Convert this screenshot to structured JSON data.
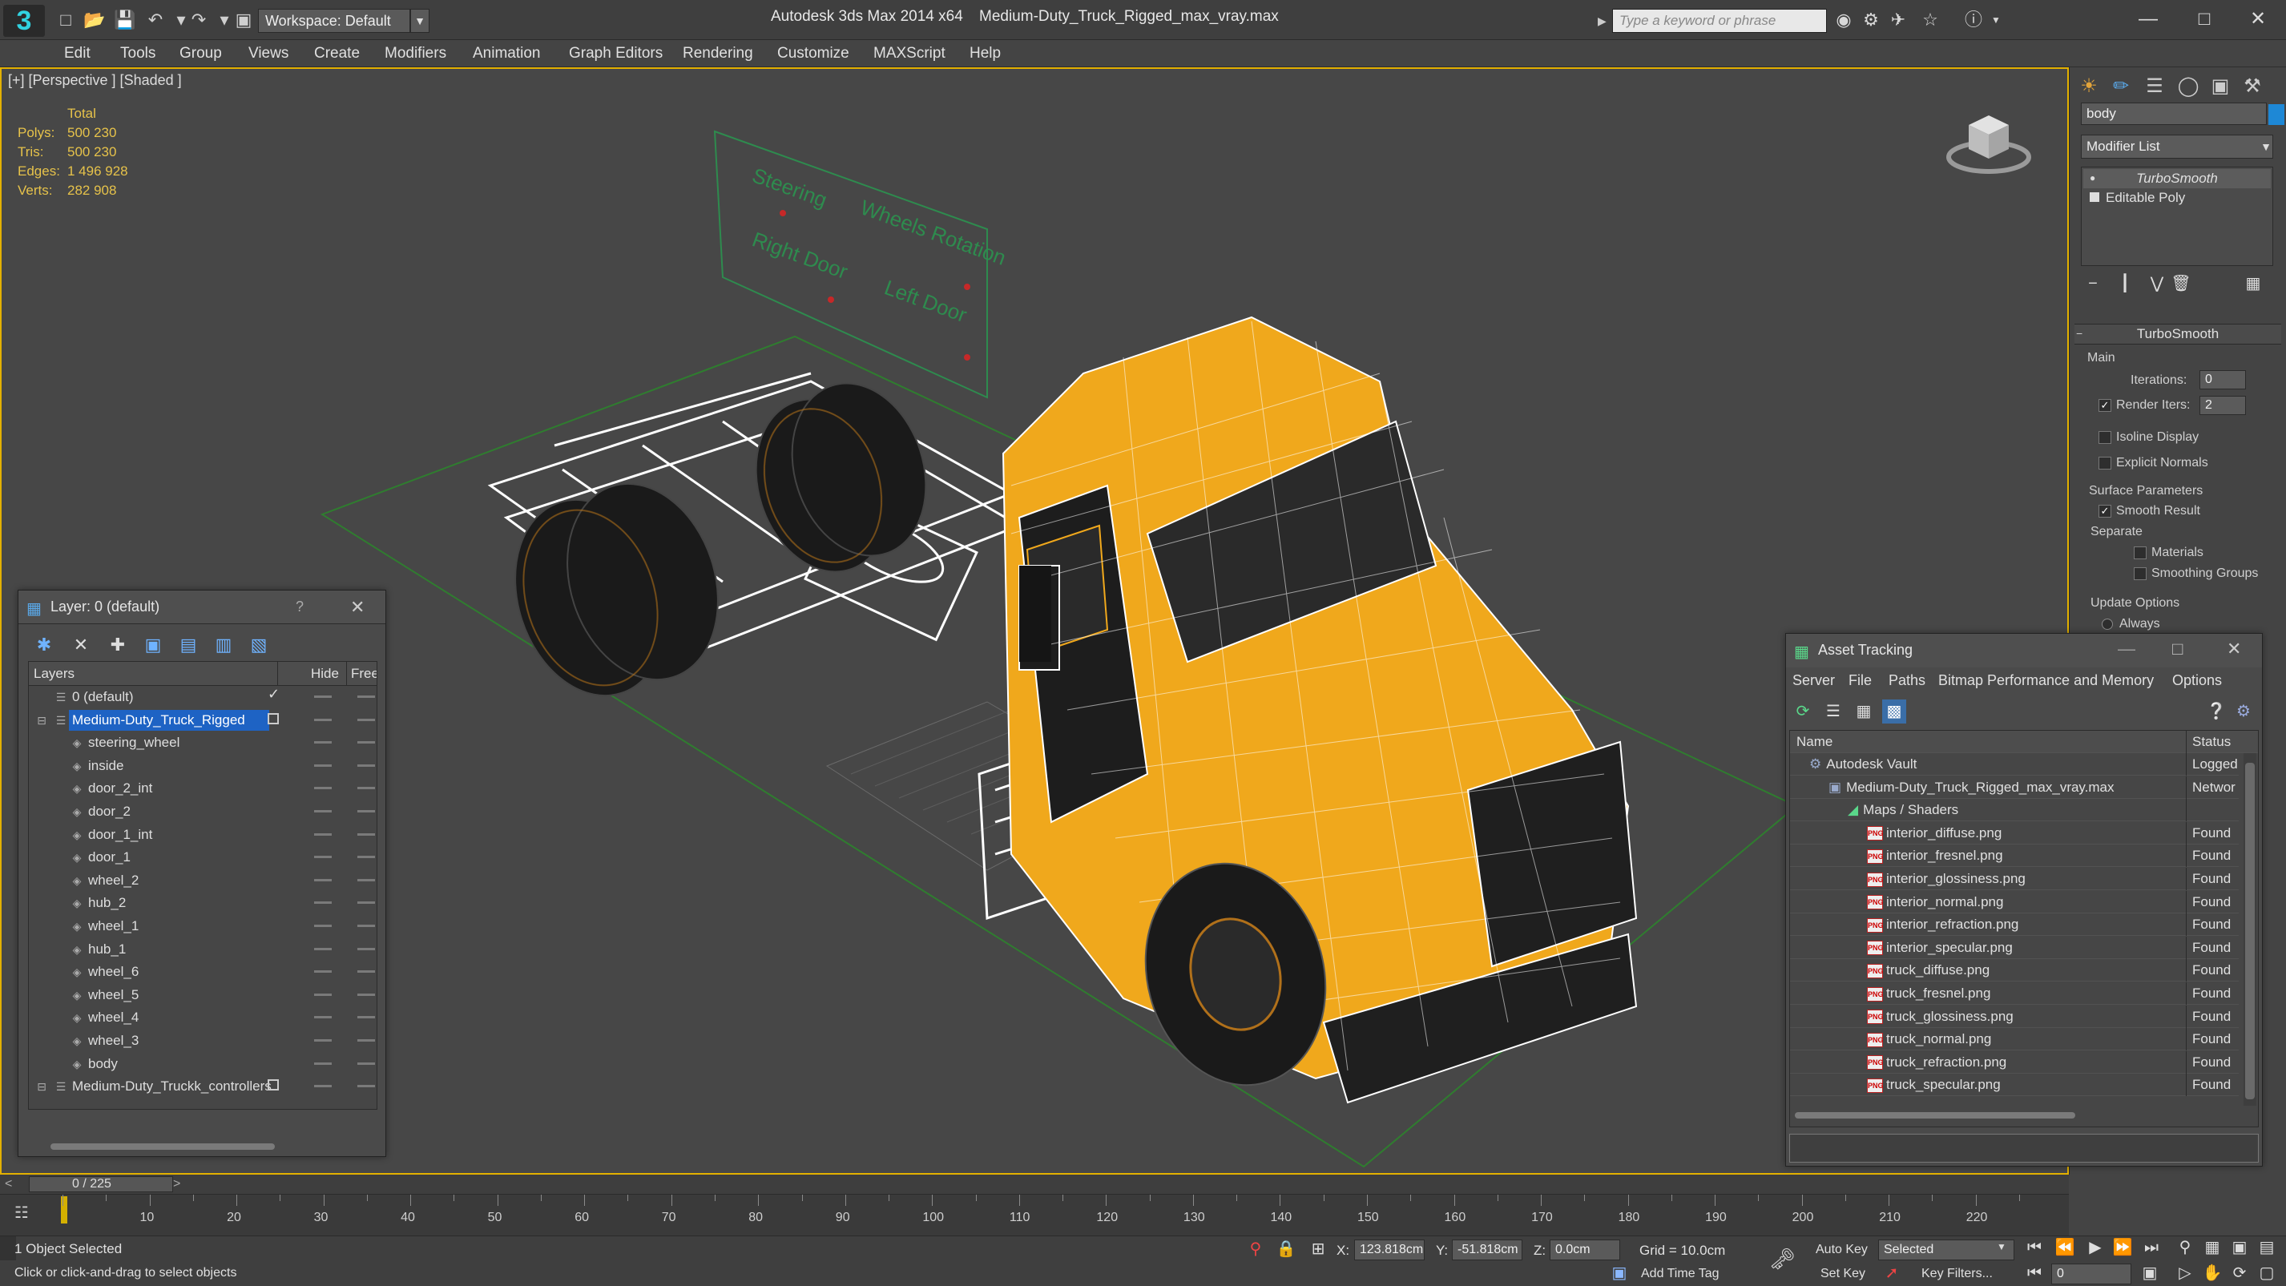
{
  "titlebar": {
    "workspace": "Workspace: Default",
    "app_title": "Autodesk 3ds Max  2014 x64",
    "file_title": "Medium-Duty_Truck_Rigged_max_vray.max",
    "search_placeholder": "Type a keyword or phrase"
  },
  "menu": [
    "Edit",
    "Tools",
    "Group",
    "Views",
    "Create",
    "Modifiers",
    "Animation",
    "Graph Editors",
    "Rendering",
    "Customize",
    "MAXScript",
    "Help"
  ],
  "viewport": {
    "label": "[+] [Perspective ] [Shaded ]",
    "stats": {
      "total_label": "Total",
      "rows": [
        {
          "key": "Polys:",
          "value": "500 230"
        },
        {
          "key": "Tris:",
          "value": "500 230"
        },
        {
          "key": "Edges:",
          "value": "1 496 928"
        },
        {
          "key": "Verts:",
          "value": "282 908"
        }
      ]
    },
    "rig_labels": [
      "Steering",
      "Wheels Rotation",
      "Right Door",
      "Left Door"
    ]
  },
  "command_panel": {
    "object_name": "body",
    "object_color": "#1e88d6",
    "modifier_list": "Modifier List",
    "stack": [
      "TurboSmooth",
      "Editable Poly"
    ],
    "rollout_title": "TurboSmooth",
    "main_label": "Main",
    "iterations_label": "Iterations:",
    "iterations_value": "0",
    "render_iters_label": "Render Iters:",
    "render_iters_value": "2",
    "isoline_label": "Isoline Display",
    "explicit_normals_label": "Explicit Normals",
    "surface_params_label": "Surface Parameters",
    "smooth_result_label": "Smooth Result",
    "separate_label": "Separate",
    "materials_label": "Materials",
    "smoothing_groups_label": "Smoothing Groups",
    "update_options_label": "Update Options",
    "always_label": "Always"
  },
  "layer_window": {
    "title": "Layer: 0 (default)",
    "help": "?",
    "columns": {
      "layers": "Layers",
      "hide": "Hide",
      "freeze": "Freez"
    },
    "rows": [
      {
        "name": "0 (default)",
        "indent": 0,
        "kind": "layer"
      },
      {
        "name": "Medium-Duty_Truck_Rigged",
        "indent": 0,
        "kind": "layer",
        "selected": true
      },
      {
        "name": "steering_wheel",
        "indent": 1,
        "kind": "object"
      },
      {
        "name": "inside",
        "indent": 1,
        "kind": "object"
      },
      {
        "name": "door_2_int",
        "indent": 1,
        "kind": "object"
      },
      {
        "name": "door_2",
        "indent": 1,
        "kind": "object"
      },
      {
        "name": "door_1_int",
        "indent": 1,
        "kind": "object"
      },
      {
        "name": "door_1",
        "indent": 1,
        "kind": "object"
      },
      {
        "name": "wheel_2",
        "indent": 1,
        "kind": "object"
      },
      {
        "name": "hub_2",
        "indent": 1,
        "kind": "object"
      },
      {
        "name": "wheel_1",
        "indent": 1,
        "kind": "object"
      },
      {
        "name": "hub_1",
        "indent": 1,
        "kind": "object"
      },
      {
        "name": "wheel_6",
        "indent": 1,
        "kind": "object"
      },
      {
        "name": "wheel_5",
        "indent": 1,
        "kind": "object"
      },
      {
        "name": "wheel_4",
        "indent": 1,
        "kind": "object"
      },
      {
        "name": "wheel_3",
        "indent": 1,
        "kind": "object"
      },
      {
        "name": "body",
        "indent": 1,
        "kind": "object"
      },
      {
        "name": "Medium-Duty_Truckk_controllers",
        "indent": 0,
        "kind": "layer"
      }
    ]
  },
  "asset_window": {
    "title": "Asset Tracking",
    "menu": [
      "Server",
      "File",
      "Paths",
      "Bitmap Performance and Memory",
      "Options"
    ],
    "columns": {
      "name": "Name",
      "status": "Status"
    },
    "rows": [
      {
        "name": "Autodesk Vault",
        "status": "Logged",
        "indent": 1,
        "kind": "vault"
      },
      {
        "name": "Medium-Duty_Truck_Rigged_max_vray.max",
        "status": "Networ",
        "indent": 2,
        "kind": "file"
      },
      {
        "name": "Maps / Shaders",
        "status": "",
        "indent": 3,
        "kind": "folder"
      },
      {
        "name": "interior_diffuse.png",
        "status": "Found",
        "indent": 4,
        "kind": "png"
      },
      {
        "name": "interior_fresnel.png",
        "status": "Found",
        "indent": 4,
        "kind": "png"
      },
      {
        "name": "interior_glossiness.png",
        "status": "Found",
        "indent": 4,
        "kind": "png"
      },
      {
        "name": "interior_normal.png",
        "status": "Found",
        "indent": 4,
        "kind": "png"
      },
      {
        "name": "interior_refraction.png",
        "status": "Found",
        "indent": 4,
        "kind": "png"
      },
      {
        "name": "interior_specular.png",
        "status": "Found",
        "indent": 4,
        "kind": "png"
      },
      {
        "name": "truck_diffuse.png",
        "status": "Found",
        "indent": 4,
        "kind": "png"
      },
      {
        "name": "truck_fresnel.png",
        "status": "Found",
        "indent": 4,
        "kind": "png"
      },
      {
        "name": "truck_glossiness.png",
        "status": "Found",
        "indent": 4,
        "kind": "png"
      },
      {
        "name": "truck_normal.png",
        "status": "Found",
        "indent": 4,
        "kind": "png"
      },
      {
        "name": "truck_refraction.png",
        "status": "Found",
        "indent": 4,
        "kind": "png"
      },
      {
        "name": "truck_specular.png",
        "status": "Found",
        "indent": 4,
        "kind": "png"
      }
    ]
  },
  "timeline": {
    "frame_label": "0 / 225",
    "ticks": [
      "10",
      "20",
      "30",
      "40",
      "50",
      "60",
      "70",
      "80",
      "90",
      "100",
      "110",
      "120",
      "130",
      "140",
      "150",
      "160",
      "170",
      "180",
      "190",
      "200",
      "210",
      "220"
    ]
  },
  "statusbar": {
    "selection": "1 Object Selected",
    "prompt": "Click or click-and-drag to select objects",
    "x_label": "X:",
    "x_value": "123.818cm",
    "y_label": "Y:",
    "y_value": "-51.818cm",
    "z_label": "Z:",
    "z_value": "0.0cm",
    "grid": "Grid = 10.0cm",
    "add_time_tag": "Add Time Tag",
    "auto_key": "Auto Key",
    "set_key": "Set Key",
    "selected_value": "Selected",
    "key_filters": "Key Filters...",
    "frame_value": "0"
  },
  "colors": {
    "accent": "#e3b100",
    "selection": "#1e63c4",
    "truck": "#f0a81c"
  }
}
